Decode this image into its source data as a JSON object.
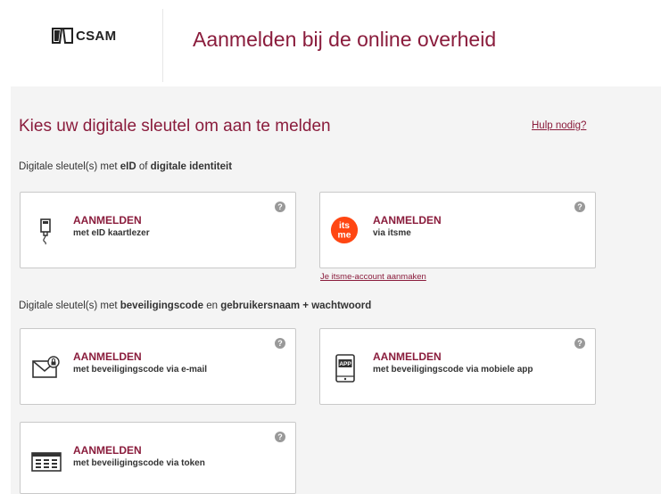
{
  "header": {
    "logo_text": "CSAM",
    "title": "Aanmelden bij de online overheid"
  },
  "main": {
    "title": "Kies uw digitale sleutel om aan te melden",
    "help_link": "Hulp nodig?"
  },
  "section1": {
    "prefix": "Digitale sleutel(s) met ",
    "bold1": "eID",
    "mid": " of ",
    "bold2": "digitale identiteit"
  },
  "section2": {
    "prefix": "Digitale sleutel(s) met ",
    "bold1": "beveiligingscode",
    "mid": " en ",
    "bold2": "gebruikersnaam + wachtwoord"
  },
  "cards": [
    {
      "title": "AANMELDEN",
      "subtitle": "met eID kaartlezer",
      "icon": "eid-card-reader-icon"
    },
    {
      "title": "AANMELDEN",
      "subtitle": "via itsme",
      "icon": "itsme-icon",
      "icon_text_top": "its",
      "icon_text_bottom": "me"
    },
    {
      "title": "AANMELDEN",
      "subtitle": "met beveiligingscode via e-mail",
      "icon": "email-lock-icon"
    },
    {
      "title": "AANMELDEN",
      "subtitle": "met beveiligingscode via mobiele app",
      "icon": "mobile-app-icon",
      "icon_text": "APP"
    },
    {
      "title": "AANMELDEN",
      "subtitle": "met beveiligingscode via token",
      "icon": "token-icon"
    }
  ],
  "itsme_link": "Je itsme-account aanmaken",
  "help_glyph": "?",
  "colors": {
    "accent": "#8a1c3c",
    "itsme": "#ff4612",
    "background": "#f4f4f4"
  }
}
